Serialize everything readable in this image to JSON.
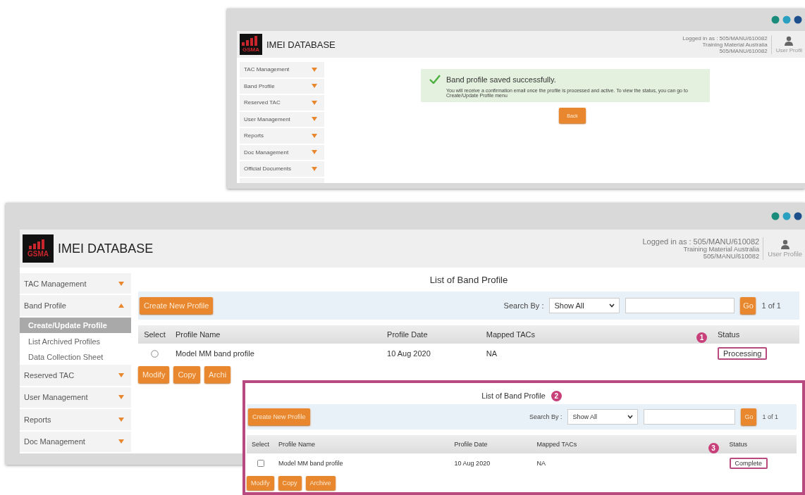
{
  "screens": [
    {
      "kind": "confirmation",
      "logo_text": "GSMA",
      "app_title": "IMEI DATABASE",
      "login": {
        "label": "Logged in as : 505/MANU/610082",
        "org": "Training Material Australia",
        "user_id": "505/MANU/610082",
        "profile_link": "User Profil"
      },
      "sidebar": {
        "items": [
          {
            "label": "TAC Management",
            "expanded": false
          },
          {
            "label": "Band Profile",
            "expanded": false
          },
          {
            "label": "Reserved TAC",
            "expanded": false
          },
          {
            "label": "User Management",
            "expanded": false
          },
          {
            "label": "Reports",
            "expanded": false
          },
          {
            "label": "Doc Management",
            "expanded": false
          },
          {
            "label": "Official Documents",
            "expanded": false
          }
        ]
      },
      "message": {
        "title": "Band profile saved successfully.",
        "body": "You will receive a confirmation email once the profile is processed and active. To view the status, you can go to Create/Update Profile menu"
      },
      "back_button": "Back"
    },
    {
      "kind": "list",
      "logo_text": "GSMA",
      "app_title": "IMEI DATABASE",
      "login": {
        "label": "Logged in as : 505/MANU/610082",
        "org": "Training Material Australia",
        "user_id": "505/MANU/610082",
        "profile_link": "User Profile"
      },
      "sidebar": {
        "items": [
          {
            "label": "TAC Management",
            "expanded": false
          },
          {
            "label": "Band Profile",
            "expanded": true,
            "children": [
              {
                "label": "Create/Update Profile",
                "selected": true
              },
              {
                "label": "List Archived Profiles",
                "selected": false
              },
              {
                "label": "Data Collection Sheet",
                "selected": false
              }
            ]
          },
          {
            "label": "Reserved TAC",
            "expanded": false
          },
          {
            "label": "User Management",
            "expanded": false
          },
          {
            "label": "Reports",
            "expanded": false
          },
          {
            "label": "Doc Management",
            "expanded": false
          }
        ]
      },
      "list": {
        "title": "List of Band Profile",
        "create_button": "Create New Profile",
        "search_label": "Search By :",
        "search_by": "Show All",
        "go_button": "Go",
        "page_info": "1 of 1",
        "columns": [
          "Select",
          "Profile Name",
          "Profile Date",
          "Mapped TACs",
          "Status"
        ],
        "status_callout": "1",
        "rows": [
          {
            "kind": "radio",
            "selected": false,
            "profile_name": "Model MM band profile",
            "profile_date": "10 Aug 2020",
            "mapped_tacs": "NA",
            "status": "Processing"
          }
        ],
        "actions": [
          "Modify",
          "Copy",
          "Archi"
        ]
      }
    },
    {
      "kind": "overlay",
      "list": {
        "title": "List of Band Profile",
        "title_callout": "2",
        "create_button": "Create New Profile",
        "search_label": "Search By :",
        "search_by": "Show All",
        "go_button": "Go",
        "page_info": "1 of 1",
        "columns": [
          "Select",
          "Profile Name",
          "Profile Date",
          "Mapped TACs",
          "Status"
        ],
        "status_callout": "3",
        "rows": [
          {
            "kind": "checkbox",
            "selected": false,
            "profile_name": "Model MM band profile",
            "profile_date": "10 Aug 2020",
            "mapped_tacs": "NA",
            "status": "Complete"
          }
        ],
        "actions": [
          "Modify",
          "Copy",
          "Archive"
        ]
      }
    }
  ]
}
